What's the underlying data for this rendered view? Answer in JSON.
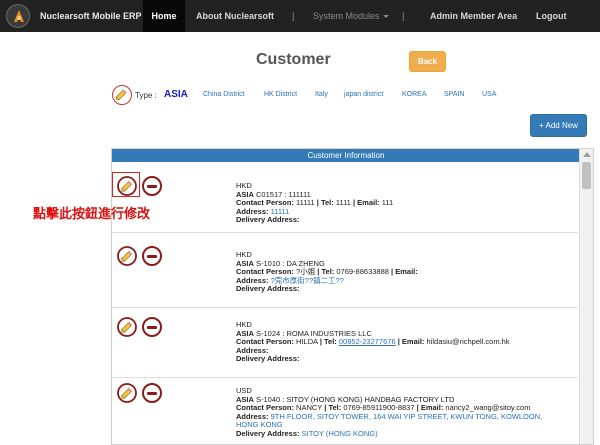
{
  "nav": {
    "brand": "Nuclearsoft Mobile ERP",
    "items": [
      {
        "label": "Home",
        "active": true
      },
      {
        "label": "About Nuclearsoft"
      },
      {
        "label": "|"
      },
      {
        "label": "System Modules"
      },
      {
        "label": "|"
      },
      {
        "label": "Admin Member Area"
      },
      {
        "label": "Logout"
      }
    ]
  },
  "page": {
    "title": "Customer",
    "back_label": "Back",
    "add_label": "+ Add New"
  },
  "type_filter": {
    "label": "Type :",
    "selected": "ASIA",
    "options": [
      "China District",
      "HK District",
      "Italy",
      "japan district",
      "KOREA",
      "SPAIN",
      "USA"
    ]
  },
  "table": {
    "header": "Customer Information",
    "hint": "點擊此按鈕進行修改",
    "labels": {
      "contact": "Contact Person:",
      "tel": "Tel:",
      "email": "Email:",
      "address": "Address:",
      "delivery": "Delivery Address:"
    },
    "rows": [
      {
        "currency": "HKD",
        "region": "ASIA",
        "code_name": "C01517 : 111111",
        "contact": "11111",
        "tel": "1111",
        "email": "111",
        "address": "11111",
        "delivery": ""
      },
      {
        "currency": "HKD",
        "region": "ASIA",
        "code_name": "S-1010 : DA ZHENG",
        "contact": "?小姐",
        "tel": "0769-88633888",
        "email": "",
        "address": "?莞市厚街??鎮二工??",
        "delivery": ""
      },
      {
        "currency": "HKD",
        "region": "ASIA",
        "code_name": "S-1024 : ROMA INDUSTRIES LLC",
        "contact": "HILDA",
        "tel": "00852-23277676",
        "email": "hildasiu@richpell.com.hk",
        "address": "",
        "delivery": ""
      },
      {
        "currency": "USD",
        "region": "ASIA",
        "code_name": "S-1040 : SITOY (HONG KONG) HANDBAG FACTORY LTD",
        "contact": "NANCY",
        "tel": "0769-85911900-8837",
        "email": "nancy2_wang@sitoy.com",
        "address_line1": "9TH FLOOR, SITOY TOWER, 164 WAI YIP STREET, KWUN TONG, KOWLOON,",
        "address_line2": "HONG KONG",
        "delivery": "SITOY (HONG KONG)"
      }
    ]
  },
  "colors": {
    "navbar": "#222222",
    "primary": "#337ab7",
    "warning": "#f0ad4e",
    "danger": "#8c1a1a",
    "hint_red": "#dd1111"
  }
}
